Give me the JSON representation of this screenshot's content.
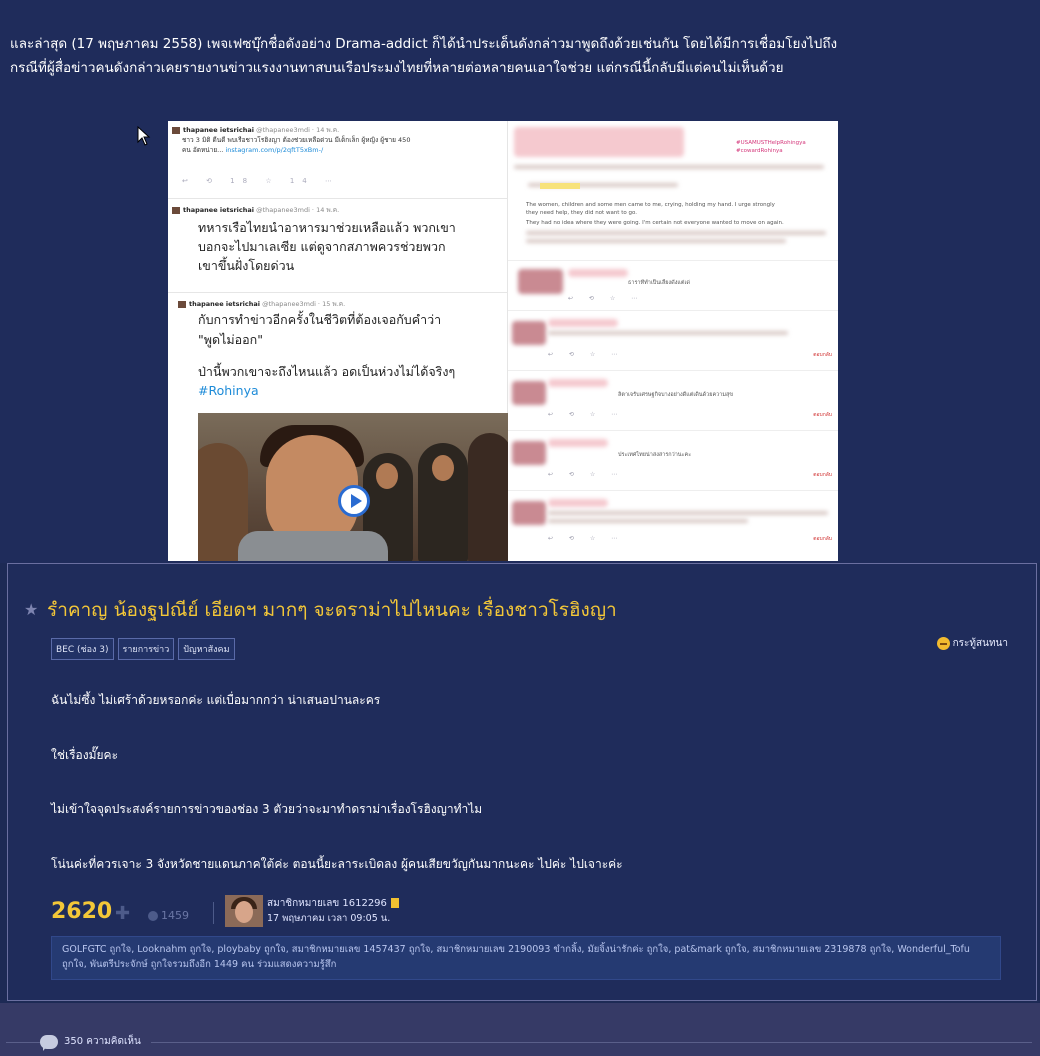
{
  "intro": {
    "line1": "และล่าสุด (17 พฤษภาคม 2558) เพจเฟซบุ๊กชื่อดังอย่าง Drama-addict ก็ได้นำประเด็นดังกล่าวมาพูดถึงด้วยเช่นกัน โดยได้มีการเชื่อมโยงไปถึง",
    "line2": "กรณีที่ผู้สื่อข่าวคนดังกล่าวเคยรายงานข่าวแรงงานทาสบนเรือประมงไทยที่หลายต่อหลายคนเอาใจช่วย แต่กรณีนี้กลับมีแต่คนไม่เห็นด้วย"
  },
  "embed": {
    "tweet1": {
      "author": "thapanee ietsrichai",
      "handle": "@thapanee3mdi · 14 พ.ค.",
      "line1": "ชาว 3 มิติ ดีนดี พบเรือชาวโรฮิงญา ต้องช่วยเหลือด่วน มีเด็กเล็ก ผู้หญิง ผู้ชาย 450",
      "line2": "คน อัดหน่าย...",
      "link": "instagram.com/p/2qftT5xBm-/",
      "actions": "↩ ⟲ 18 ☆ 14 ⋯"
    },
    "tweet2": {
      "author": "thapanee ietsrichai",
      "handle": "@thapanee3mdi · 14 พ.ค.",
      "line1": "ทหารเรือไทยนำอาหารมาช่วยเหลือแล้ว พวกเขา",
      "line2": "บอกจะไปมาเลเซีย แต่ดูจากสภาพควรช่วยพวก",
      "line3": "เขาขึ้นฝั่งโดยด่วน"
    },
    "tweet3": {
      "author": "thapanee ietsrichai",
      "handle": "@thapanee3mdi · 15 พ.ค.",
      "line1": "กับการทำข่าวอีกครั้งในชีวิตที่ต้องเจอกับคำว่า",
      "line2": "\"พูดไม่ออก\"",
      "line3": "ป่านี้พวกเขาจะถึงไหนแล้ว อดเป็นห่วงไม่ได้จริงๆ",
      "hashtag": "#Rohinya"
    },
    "right": {
      "hash1": "#USAMUSTHelpRohingya",
      "hash2": "#cowardRohinya",
      "q1": "The women, children and some men came to me, crying, holding my hand. I urge strongly",
      "q2": "they need help, they did not want to go.",
      "q3": "They had no idea where they were going. I'm certain not everyone wanted to move on again.",
      "r1": "ธาราที่ทำเป็นเลี้ยงดังแต่เด่",
      "r2": "ลิตาเจรับเศรษฐกิจบางอย่างดีแต่เดินด้วยความสุข",
      "r3": "ประเทศไทยน่าสงสารกว่านะคะ",
      "reply": "ตอบกลับ"
    }
  },
  "post": {
    "title": "รำคาญ น้องฐปณีย์ เอียดฯ มากๆ จะดราม่าไปไหนคะ เรื่องชาวโรฮิงญา",
    "tags": [
      "BEC (ช่อง 3)",
      "รายการข่าว",
      "ปัญหาสังคม"
    ],
    "kind_label": "กระทู้สนทนา",
    "paragraphs": [
      "ฉันไม่ซึ้ง ไม่เศร้าด้วยหรอกค่ะ แต่เบื่อมากกว่า น่าเสนอปานละคร",
      "ใช่เรื่องมั๊ยคะ",
      "ไม่เข้าใจจุดประสงค์รายการข่าวของช่อง 3 ตัวยว่าจะมาทำดราม่าเรื่องโรฮิงญาทำไม",
      "โน่นค่ะที่ควรเจาะ 3 จังหวัดชายแดนภาคใต้ค่ะ ตอนนี้ยะลาระเบิดลง ผู้คนเสียขวัญกันมากนะคะ ไปค่ะ ไปเจาะค่ะ"
    ],
    "votes": "2620",
    "emotion_count": "1459",
    "author": "สมาชิกหมายเลข 1612296",
    "date": "17 พฤษภาคม เวลา 09:05 น.",
    "likers": "GOLFGTC ถูกใจ, Looknahm ถูกใจ, ploybaby ถูกใจ, สมาชิกหมายเลข 1457437 ถูกใจ, สมาชิกหมายเลข 2190093 ขำกลิ้ง, มัยจิ้งน่ารักค่ะ ถูกใจ, pat&mark ถูกใจ, สมาชิกหมายเลข 2319878 ถูกใจ, Wonderful_Tofu ถูกใจ, พันตรีประจักษ์ ถูกใจรวมถึงอีก 1449 คน ร่วมแสดงความรู้สึก"
  },
  "footer": {
    "comments": "350 ความคิดเห็น"
  },
  "colors": {
    "background": "#1f2c5b",
    "title": "#f3c738",
    "votes": "#f3c738",
    "likers_bg": "#253a72"
  },
  "icons": [
    "cursor-icon",
    "star-icon",
    "chat-icon",
    "plus-icon",
    "emotion-icon",
    "member-badge-icon",
    "comment-icon",
    "play-icon"
  ]
}
